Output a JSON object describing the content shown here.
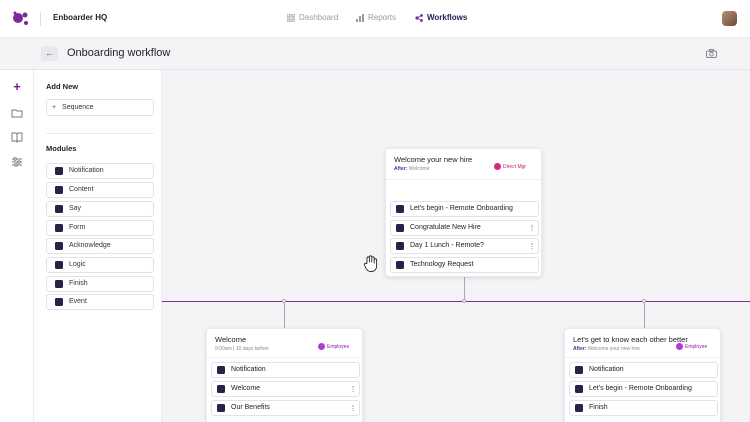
{
  "header": {
    "brand": "Enboarder HQ",
    "nav": [
      {
        "label": "Dashboard",
        "icon": "grid-icon",
        "active": false
      },
      {
        "label": "Reports",
        "icon": "bar-chart-icon",
        "active": false
      },
      {
        "label": "Workflows",
        "icon": "workflow-icon",
        "active": true
      }
    ]
  },
  "titlebar": {
    "title": "Onboarding workflow"
  },
  "panel": {
    "add_new_heading": "Add New",
    "sequence_button": "Sequence",
    "modules_heading": "Modules",
    "modules": [
      "Notification",
      "Content",
      "Say",
      "Form",
      "Acknowledge",
      "Logic",
      "Finish",
      "Event"
    ]
  },
  "cards": {
    "welcome_hire": {
      "title": "Welcome your new hire",
      "after_label": "After:",
      "after_value": "Welcome",
      "badge": "Direct Mgr",
      "items": [
        "Let's begin - Remote Onboarding",
        "Congratulate New Hire",
        "Day 1 Lunch - Remote?",
        "Technology Request"
      ]
    },
    "welcome": {
      "title": "Welcome",
      "subtitle": "9:00am | 10 days before",
      "badge": "Employee",
      "items": [
        "Notification",
        "Welcome",
        "Our Benefits"
      ]
    },
    "know_each_other": {
      "title": "Let's get to know each other better",
      "after_label": "After:",
      "after_value": "Welcome your new hire",
      "badge": "Employee",
      "items": [
        "Notification",
        "Let's begin - Remote Onboarding",
        "Finish"
      ]
    }
  },
  "colors": {
    "accent": "#7c2a9a",
    "icon_dark": "#2b2048"
  }
}
